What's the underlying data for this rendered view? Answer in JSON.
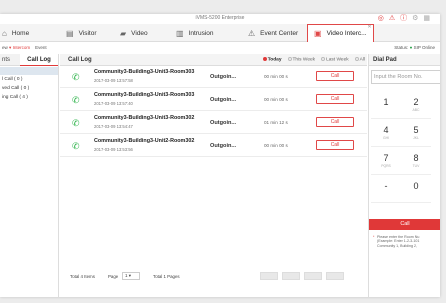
{
  "window": {
    "title": "iVMS-5200 Enterprise"
  },
  "titlebar_icons": [
    {
      "name": "notify-icon",
      "glyph": "◎",
      "highlight": true
    },
    {
      "name": "alarm-icon",
      "glyph": "⚠",
      "highlight": true
    },
    {
      "name": "warn-icon",
      "glyph": "ⓘ",
      "highlight": true
    },
    {
      "name": "tool-icon",
      "glyph": "⚙",
      "highlight": false
    },
    {
      "name": "grid-icon",
      "glyph": "▦",
      "highlight": false
    }
  ],
  "tabs": [
    {
      "label": "Home",
      "icon": "home-icon",
      "glyph": "⌂",
      "active": false
    },
    {
      "label": "Visitor",
      "icon": "visitor-icon",
      "glyph": "▤",
      "active": false
    },
    {
      "label": "Video",
      "icon": "video-icon",
      "glyph": "▰",
      "active": false
    },
    {
      "label": "Intrusion",
      "icon": "intrusion-icon",
      "glyph": "▥",
      "active": false
    },
    {
      "label": "Event Center",
      "icon": "event-center-icon",
      "glyph": "⚠",
      "active": false
    },
    {
      "label": "Video Interc...",
      "icon": "video-intercom-icon",
      "glyph": "▣",
      "active": true
    }
  ],
  "breadcrumb": {
    "left_prefix": "ew",
    "arrow": "▾",
    "intercom": "Intercom",
    "event": "Event",
    "status_label": "Status:",
    "status_value": "SIP Online"
  },
  "left_panel": {
    "tab_a": "nts",
    "tab_b": "Call Log",
    "items": [
      {
        "label": "",
        "selected": true
      },
      {
        "label": "l Call ( 0 )",
        "selected": false
      },
      {
        "label": "ved Call ( 0 )",
        "selected": false
      },
      {
        "label": "ing Call ( 4 )",
        "selected": false
      }
    ]
  },
  "call_log": {
    "title": "Call Log",
    "filters": [
      {
        "label": "Today",
        "selected": true
      },
      {
        "label": "This Week",
        "selected": false
      },
      {
        "label": "Last Week",
        "selected": false
      },
      {
        "label": "All",
        "selected": false
      }
    ],
    "rows": [
      {
        "name": "Community3-Building3-Unit3-Room303",
        "date": "2017-03-09 13:57:58",
        "direction": "Outgoin...",
        "duration": "00 min 00 s",
        "action": "Call"
      },
      {
        "name": "Community3-Building3-Unit3-Room303",
        "date": "2017-03-09 13:57:40",
        "direction": "Outgoin...",
        "duration": "00 min 00 s",
        "action": "Call"
      },
      {
        "name": "Community3-Building3-Unit3-Room302",
        "date": "2017-03-09 13:54:47",
        "direction": "Outgoin...",
        "duration": "01 min 12 s",
        "action": "Call"
      },
      {
        "name": "Community3-Building3-Unit2-Room302",
        "date": "2017-03-09 13:53:56",
        "direction": "Outgoin...",
        "duration": "00 min 00 s",
        "action": "Call"
      }
    ],
    "footer": {
      "total": "Total 4 Items",
      "page_label": "Page",
      "page_value": "1",
      "total_pages": "Total 1 Pages"
    }
  },
  "dial_pad": {
    "title": "Dial Pad",
    "input_placeholder": "Input the Room No.",
    "keys": [
      {
        "digit": "1",
        "sub": ""
      },
      {
        "digit": "2",
        "sub": "ABC"
      },
      {
        "digit": "4",
        "sub": "GHI"
      },
      {
        "digit": "5",
        "sub": "JKL"
      },
      {
        "digit": "7",
        "sub": "PQRS"
      },
      {
        "digit": "8",
        "sub": "TUV"
      },
      {
        "digit": "-",
        "sub": ""
      },
      {
        "digit": "0",
        "sub": ""
      }
    ],
    "call_label": "Call",
    "note": "Please enter the Room Nu\n(Example: Enter 1-2-3-101\nCommunity 1, Building 2,"
  },
  "colors": {
    "accent": "#e03a3a",
    "online": "#2aa14a",
    "call_icon": "#2db34a"
  }
}
